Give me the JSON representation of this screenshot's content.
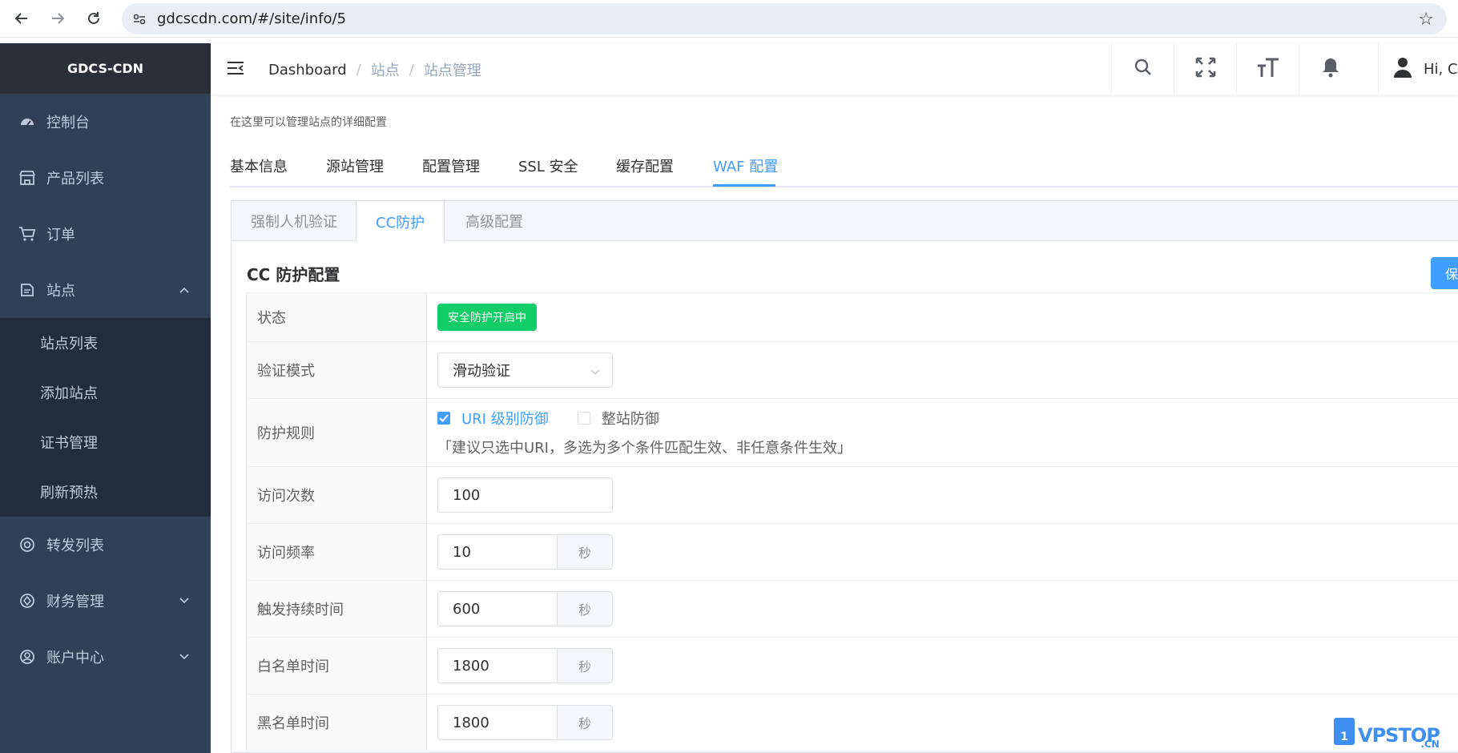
{
  "browser": {
    "url": "gdcscdn.com/#/site/info/5"
  },
  "sidebar": {
    "brand": "GDCS-CDN",
    "items": [
      {
        "label": "控制台",
        "icon": "dashboard-icon"
      },
      {
        "label": "产品列表",
        "icon": "shop-icon"
      },
      {
        "label": "订单",
        "icon": "cart-icon"
      },
      {
        "label": "站点",
        "icon": "site-icon"
      },
      {
        "label": "转发列表",
        "icon": "forward-icon"
      },
      {
        "label": "财务管理",
        "icon": "finance-icon"
      },
      {
        "label": "账户中心",
        "icon": "account-icon"
      }
    ],
    "site_submenu": [
      "站点列表",
      "添加站点",
      "证书管理",
      "刷新预热"
    ]
  },
  "header": {
    "breadcrumb": [
      "Dashboard",
      "站点",
      "站点管理"
    ],
    "breadcrumb_sep": "/",
    "greeting": "Hi, Ces"
  },
  "main": {
    "description": "在这里可以管理站点的详细配置",
    "tabs": [
      "基本信息",
      "源站管理",
      "配置管理",
      "SSL 安全",
      "缓存配置",
      "WAF 配置"
    ],
    "active_tab": "WAF 配置",
    "sub_tabs": [
      "强制人机验证",
      "CC防护",
      "高级配置"
    ],
    "active_sub_tab": "CC防护",
    "section_title": "CC 防护配置",
    "save_label": "保",
    "form": {
      "status_label": "状态",
      "status_value": "安全防护开启中",
      "verify_mode_label": "验证模式",
      "verify_mode_value": "滑动验证",
      "rule_label": "防护规则",
      "rule_uri": "URI 级别防御",
      "rule_uri_checked": true,
      "rule_site": "整站防御",
      "rule_site_checked": false,
      "rule_hint": "「建议只选中URI，多选为多个条件匹配生效、非任意条件生效」",
      "visits_label": "访问次数",
      "visits_value": "100",
      "freq_label": "访问频率",
      "freq_value": "10",
      "duration_label": "触发持续时间",
      "duration_value": "600",
      "whitelist_label": "白名单时间",
      "whitelist_value": "1800",
      "blacklist_label": "黑名单时间",
      "blacklist_value": "1800",
      "unit": "秒"
    }
  },
  "watermark": {
    "badge": "1",
    "text": "VPSTOP",
    "suffix": ".CN"
  },
  "colors": {
    "sidebar_bg": "#304156",
    "submenu_bg": "#1f2d3d",
    "accent": "#409eff",
    "status_green": "#13ce66"
  }
}
